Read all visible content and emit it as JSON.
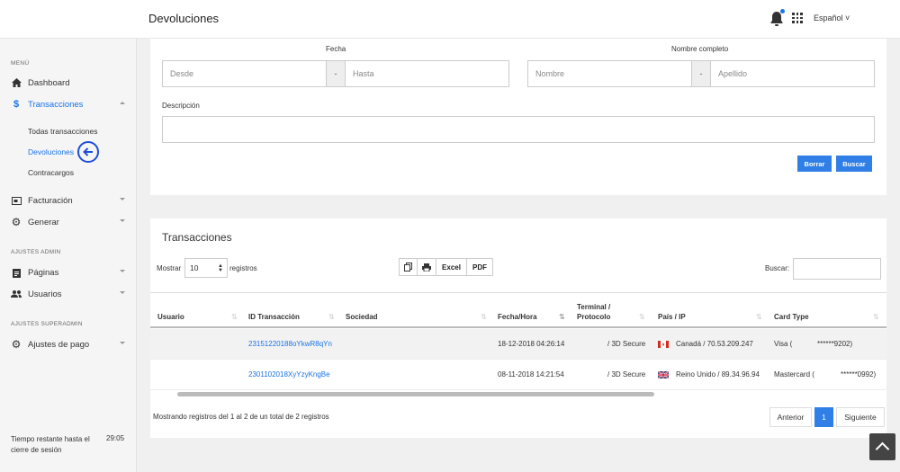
{
  "header": {
    "title": "Devoluciones",
    "language": "Español"
  },
  "sidebar": {
    "menu_heading": "MENÚ",
    "dashboard": "Dashboard",
    "transacciones": "Transacciones",
    "sub_items": [
      "Todas transacciones",
      "Devoluciones",
      "Contracargos"
    ],
    "facturacion": "Facturación",
    "generar": "Generar",
    "admin_heading": "AJUSTES ADMIN",
    "paginas": "Páginas",
    "usuarios": "Usuarios",
    "superadmin_heading": "AJUSTES SUPERADMIN",
    "ajustes_pago": "Ajustes de pago",
    "session_label": "Tiempo restante hasta el cierre de sesión",
    "session_time": "29:05"
  },
  "filters": {
    "fecha_label": "Fecha",
    "desde_placeholder": "Desde",
    "hasta_placeholder": "Hasta",
    "nombre_label": "Nombre completo",
    "nombre_placeholder": "Nombre",
    "apellido_placeholder": "Apellido",
    "separator": "-",
    "descripcion_label": "Descripción",
    "borrar": "Borrar",
    "buscar": "Buscar"
  },
  "table_card": {
    "title": "Transacciones",
    "mostrar": "Mostrar",
    "page_size": "10",
    "registros": "registros",
    "excel": "Excel",
    "pdf": "PDF",
    "buscar_label": "Buscar:",
    "columns": [
      "Usuario",
      "ID Transacción",
      "Sociedad",
      "Fecha/Hora",
      "Terminal / Protocolo",
      "País / IP",
      "Card Type"
    ],
    "rows": [
      {
        "usuario": "",
        "id": "23151220188oYkwR8qYn",
        "sociedad": "",
        "fecha": "18-12-2018 04:26:14",
        "terminal": "/ 3D Secure",
        "pais": "Canadá / 70.53.209.247",
        "card": "Visa (",
        "card_num": "******9202)"
      },
      {
        "usuario": "",
        "id": "2301102018XyYzyKngBe",
        "sociedad": "",
        "fecha": "08-11-2018 14:21:54",
        "terminal": "/ 3D Secure",
        "pais": "Reino Unido / 89.34.96.94",
        "card": "Mastercard (",
        "card_num": "******0992)"
      }
    ],
    "info": "Mostrando registros del 1 al 2 de un total de 2 registros",
    "anterior": "Anterior",
    "page": "1",
    "siguiente": "Siguiente"
  },
  "colors": {
    "accent": "#2f7fe6",
    "link": "#1a73e8"
  }
}
